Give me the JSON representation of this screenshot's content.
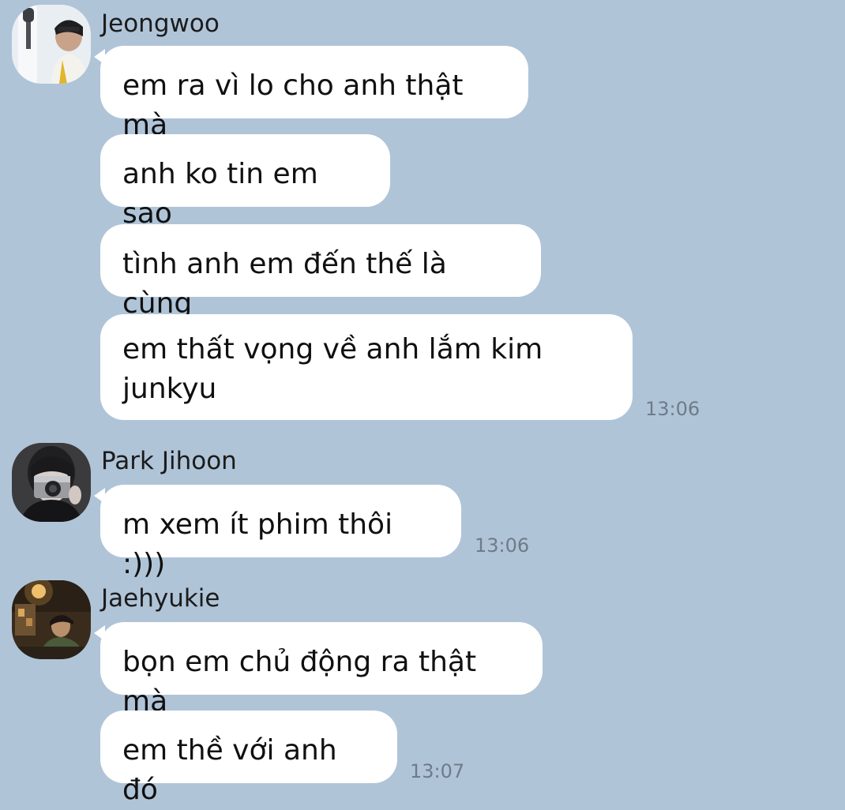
{
  "colors": {
    "background": "#b0c4d8",
    "bubble": "#ffffff",
    "timestamp": "#6e7b89"
  },
  "groups": [
    {
      "sender": "Jeongwoo",
      "avatar": "jeongwoo-avatar-icon",
      "messages": [
        "em ra vì lo cho anh thật mà",
        "anh ko tin em sao",
        "tình anh em đến thế là cùng",
        "em thất vọng về anh lắm kim\njunkyu"
      ],
      "time": "13:06"
    },
    {
      "sender": "Park Jihoon",
      "avatar": "park-jihoon-avatar-icon",
      "messages": [
        "m xem ít phim thôi :)))"
      ],
      "time": "13:06"
    },
    {
      "sender": "Jaehyukie",
      "avatar": "jaehyukie-avatar-icon",
      "messages": [
        "bọn em chủ động ra thật mà",
        "em thề với anh đó"
      ],
      "time": "13:07"
    }
  ]
}
